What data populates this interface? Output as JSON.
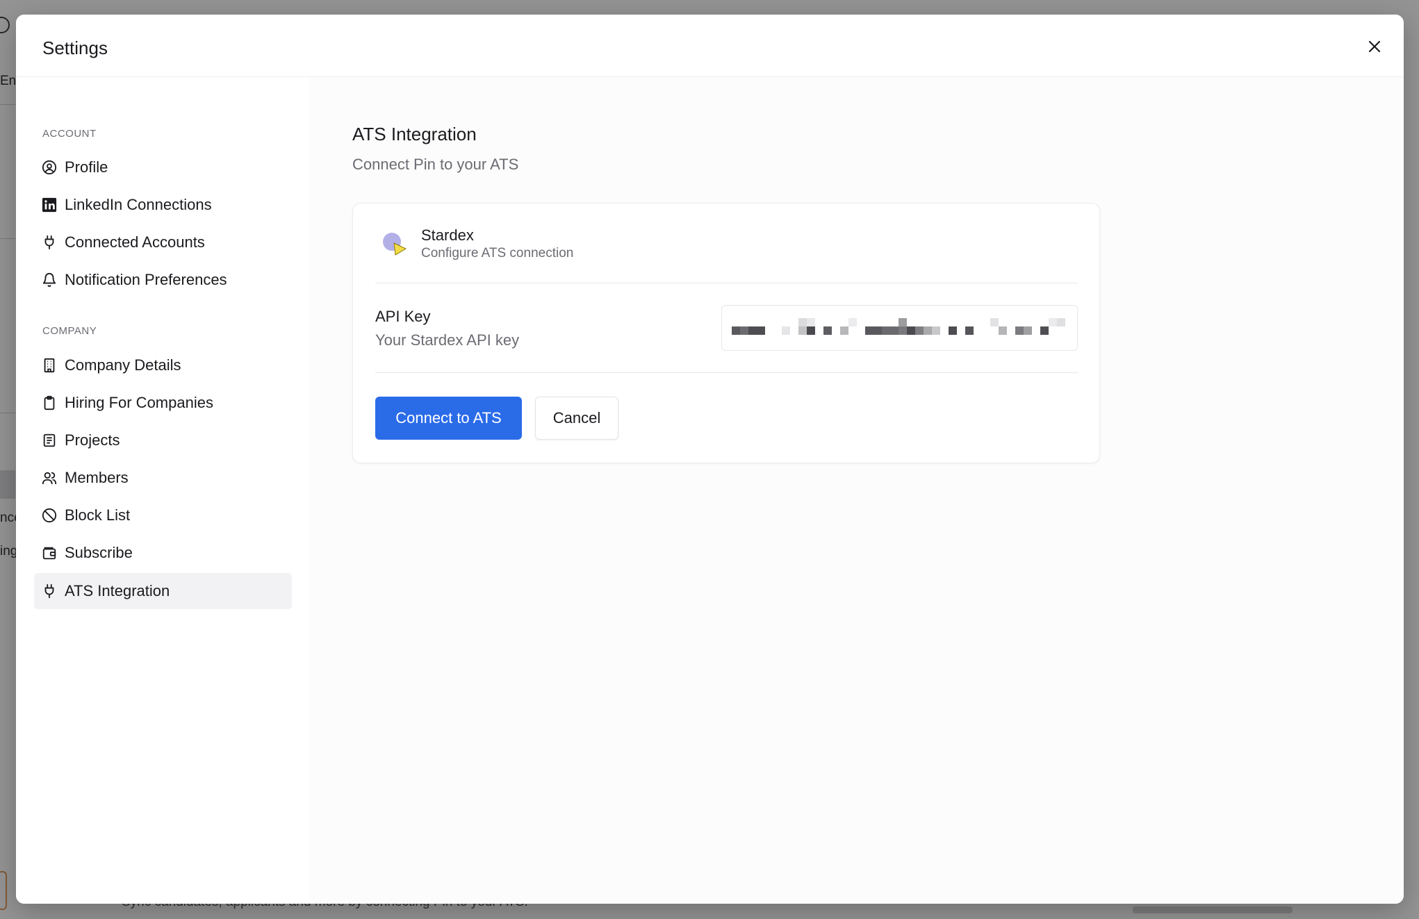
{
  "background": {
    "fragments": [
      "En",
      "nce",
      "ing"
    ],
    "footer_text": "Sync candidates, applicants and more by connecting Pin to your ATS."
  },
  "modal": {
    "title": "Settings",
    "close_icon": "close-icon"
  },
  "sidebar": {
    "account_label": "ACCOUNT",
    "company_label": "COMPANY",
    "account_items": [
      {
        "label": "Profile",
        "icon": "user-circle-icon"
      },
      {
        "label": "LinkedIn Connections",
        "icon": "linkedin-icon"
      },
      {
        "label": "Connected Accounts",
        "icon": "plug-icon"
      },
      {
        "label": "Notification Preferences",
        "icon": "bell-icon"
      }
    ],
    "company_items": [
      {
        "label": "Company Details",
        "icon": "building-icon"
      },
      {
        "label": "Hiring For Companies",
        "icon": "clipboard-icon"
      },
      {
        "label": "Projects",
        "icon": "list-icon"
      },
      {
        "label": "Members",
        "icon": "users-icon"
      },
      {
        "label": "Block List",
        "icon": "ban-icon"
      },
      {
        "label": "Subscribe",
        "icon": "wallet-icon"
      },
      {
        "label": "ATS Integration",
        "icon": "plug-icon",
        "active": true
      }
    ]
  },
  "content": {
    "title": "ATS Integration",
    "subtitle": "Connect Pin to your ATS",
    "provider": {
      "name": "Stardex",
      "description": "Configure ATS connection",
      "logo_icon": "stardex-logo-icon"
    },
    "api_key": {
      "label": "API Key",
      "help": "Your Stardex API key",
      "value": "(redacted)"
    },
    "connect_button": "Connect to ATS",
    "cancel_button": "Cancel",
    "colors": {
      "primary": "#2a6be8",
      "logo_purple": "#b3b0e8",
      "logo_yellow": "#f3dc45"
    }
  }
}
